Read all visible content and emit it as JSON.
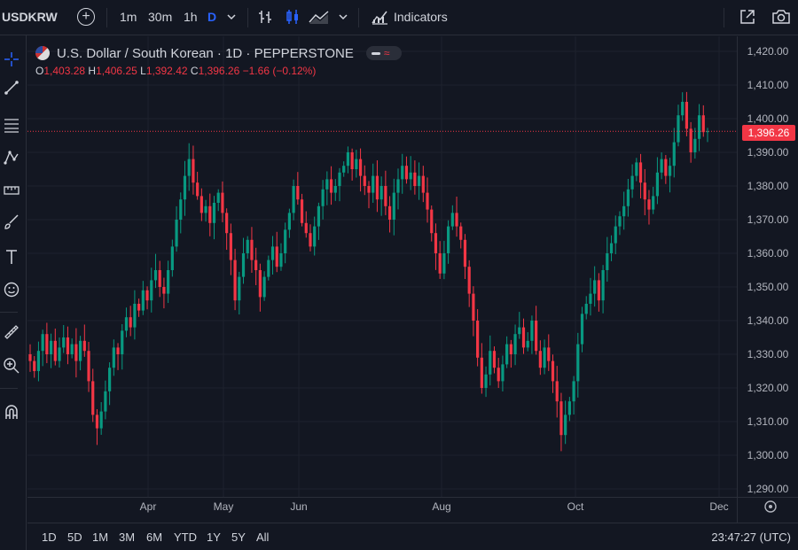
{
  "toolbar": {
    "symbol": "USDKRW",
    "intervals": [
      "1m",
      "30m",
      "1h",
      "D"
    ],
    "indicators_label": "Indicators"
  },
  "legend": {
    "title": "U.S. Dollar / South Korean · 1D · PEPPERSTONE",
    "open_label": "O",
    "open": "1,403.28",
    "high_label": "H",
    "high": "1,406.25",
    "low_label": "L",
    "low": "1,392.42",
    "close_label": "C",
    "close": "1,396.26",
    "change": "−1.66 (−0.12%)"
  },
  "price_tag": "1,396.26",
  "bottom": {
    "ranges": [
      "1D",
      "5D",
      "1M",
      "3M",
      "6M",
      "YTD",
      "1Y",
      "5Y",
      "All"
    ],
    "clock": "23:47:27 (UTC)"
  },
  "colors": {
    "up": "#089981",
    "down": "#f23645",
    "bg": "#131722",
    "grid": "#2a2e39",
    "accent": "#2962ff"
  },
  "chart_data": {
    "type": "candlestick",
    "y_ticks": [
      "1,420.00",
      "1,410.00",
      "1,400.00",
      "1,390.00",
      "1,380.00",
      "1,370.00",
      "1,360.00",
      "1,350.00",
      "1,340.00",
      "1,330.00",
      "1,320.00",
      "1,310.00",
      "1,300.00",
      "1,290.00"
    ],
    "ylim": [
      1290,
      1420
    ],
    "x_ticks": [
      "Apr",
      "May",
      "Jun",
      "Aug",
      "Oct",
      "Dec"
    ],
    "last_price": 1396.26,
    "closes": [
      1328,
      1325,
      1331,
      1336,
      1330,
      1334,
      1328,
      1332,
      1335,
      1330,
      1333,
      1328,
      1334,
      1331,
      1322,
      1312,
      1308,
      1313,
      1319,
      1326,
      1332,
      1330,
      1337,
      1341,
      1338,
      1345,
      1343,
      1349,
      1346,
      1352,
      1355,
      1350,
      1348,
      1355,
      1362,
      1370,
      1376,
      1383,
      1388,
      1381,
      1377,
      1372,
      1374,
      1369,
      1375,
      1378,
      1372,
      1366,
      1358,
      1346,
      1353,
      1360,
      1364,
      1358,
      1355,
      1347,
      1353,
      1358,
      1362,
      1356,
      1360,
      1367,
      1372,
      1380,
      1376,
      1369,
      1366,
      1362,
      1368,
      1374,
      1379,
      1382,
      1378,
      1380,
      1384,
      1386,
      1390,
      1385,
      1388,
      1383,
      1380,
      1378,
      1383,
      1376,
      1380,
      1374,
      1370,
      1378,
      1382,
      1386,
      1382,
      1384,
      1380,
      1383,
      1378,
      1373,
      1366,
      1360,
      1354,
      1360,
      1368,
      1372,
      1368,
      1364,
      1356,
      1348,
      1340,
      1329,
      1320,
      1324,
      1331,
      1326,
      1322,
      1327,
      1333,
      1330,
      1336,
      1338,
      1332,
      1334,
      1340,
      1331,
      1326,
      1332,
      1328,
      1322,
      1316,
      1306,
      1312,
      1316,
      1322,
      1333,
      1342,
      1345,
      1348,
      1352,
      1346,
      1355,
      1360,
      1363,
      1368,
      1371,
      1374,
      1379,
      1383,
      1387,
      1381,
      1376,
      1373,
      1377,
      1384,
      1388,
      1383,
      1386,
      1393,
      1401,
      1405,
      1397,
      1390,
      1394,
      1401,
      1396,
      1396.26
    ]
  }
}
